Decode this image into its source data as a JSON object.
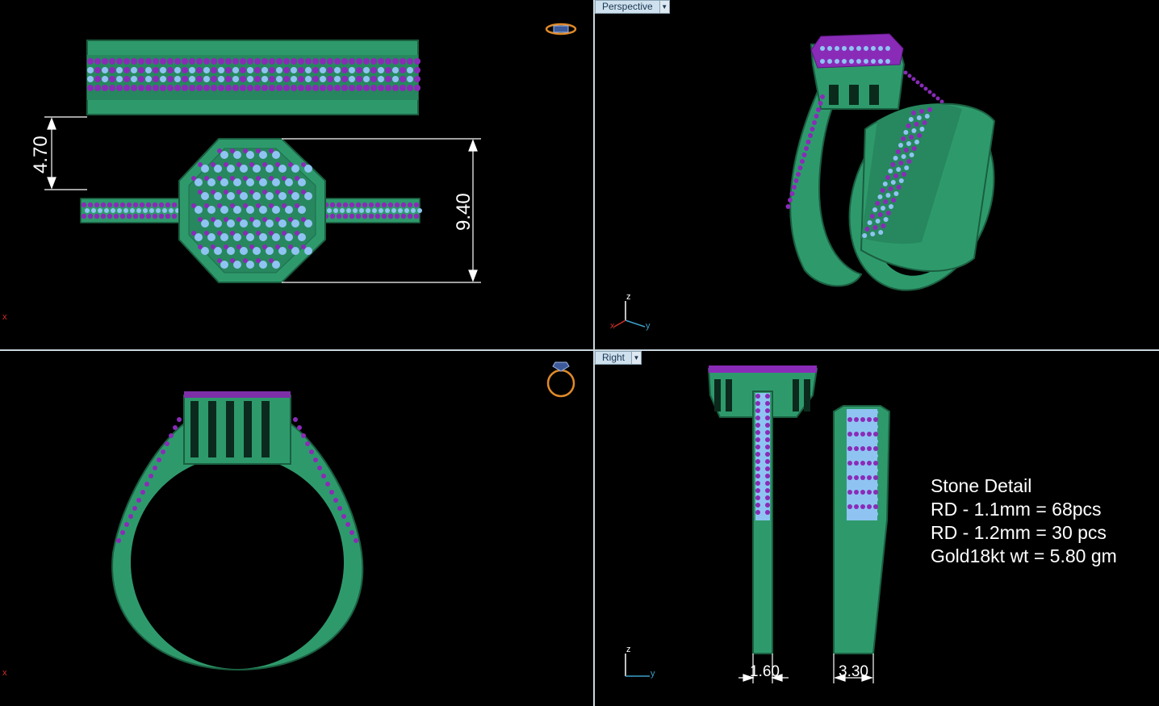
{
  "viewports": {
    "top": {
      "axis_x": "x"
    },
    "perspective": {
      "label": "Perspective",
      "axis_z": "z",
      "axis_y": "y",
      "axis_x": "x"
    },
    "front": {
      "axis_x": "x"
    },
    "right": {
      "label": "Right",
      "axis_z": "z",
      "axis_y": "y"
    }
  },
  "dimensions": {
    "shank_gap": "4.70",
    "head_height": "9.40",
    "shank_width_engagement": "1.60",
    "shank_width_band": "3.30"
  },
  "stone_detail": {
    "title": "Stone Detail",
    "line1": "RD - 1.1mm = 68pcs",
    "line2": "RD - 1.2mm = 30 pcs",
    "line3": "Gold18kt wt = 5.80 gm"
  },
  "colors": {
    "metal": "#2e9a6c",
    "metal_dark": "#1f6e4c",
    "stone_purple": "#8a2bb8",
    "stone_light": "#8fc4f2",
    "background": "#000000",
    "dimension": "#ffffff",
    "axis_x": "#d0302a",
    "axis_y": "#3aa0c8",
    "axis_z": "#ffffff"
  },
  "icons": {
    "ring_top_icon": "ring-top-icon",
    "ring_front_icon": "ring-front-icon",
    "dropdown_icon": "dropdown-arrow-icon"
  }
}
